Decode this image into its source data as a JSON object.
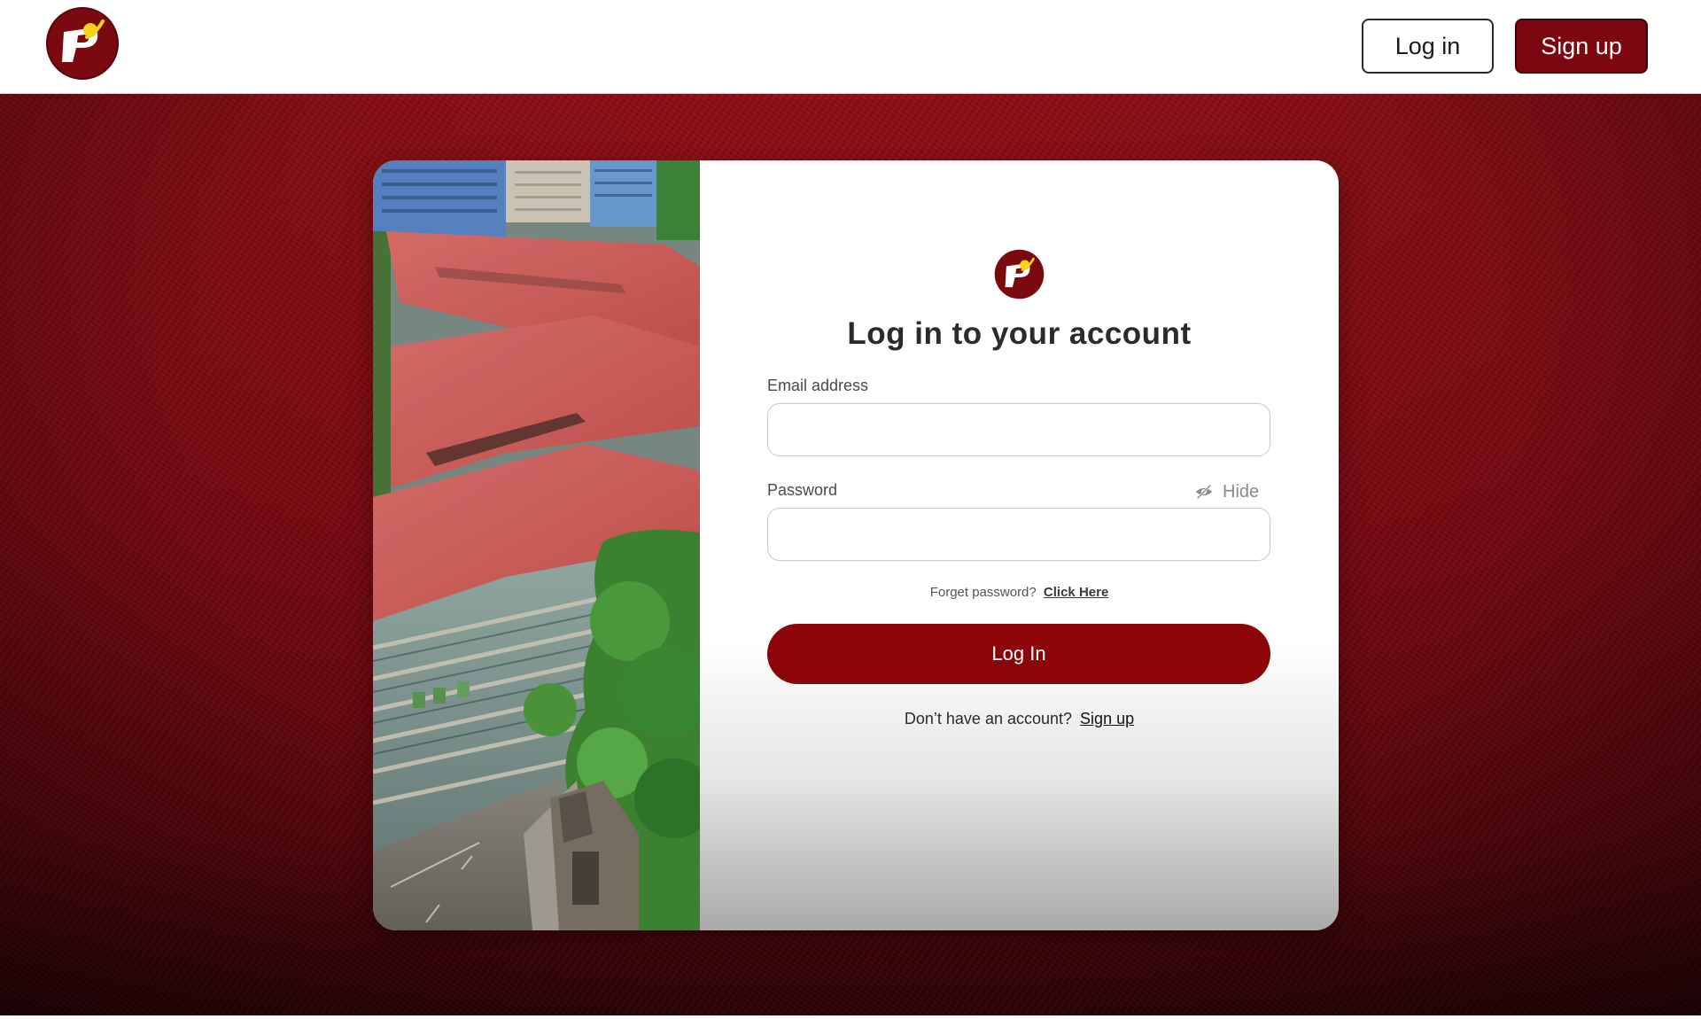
{
  "header": {
    "logo_icon": "university-seal-logo",
    "login_label": "Log in",
    "signup_label": "Sign up"
  },
  "card": {
    "image_icon": "campus-aerial-photo",
    "logo_icon": "university-seal-logo",
    "title": "Log in to your account",
    "email": {
      "label": "Email address",
      "value": "",
      "placeholder": ""
    },
    "password": {
      "label": "Password",
      "value": "",
      "placeholder": "",
      "toggle_icon": "eye-slash-icon",
      "toggle_label": "Hide"
    },
    "forgot": {
      "prefix": "Forget password?",
      "link": "Click Here"
    },
    "login_button": "Log In",
    "signup": {
      "prefix": "Don’t have an account?",
      "link": "Sign up"
    }
  },
  "colors": {
    "brand": "#7d0710",
    "primary_button": "#8c0509",
    "background": "#8a0a12"
  }
}
